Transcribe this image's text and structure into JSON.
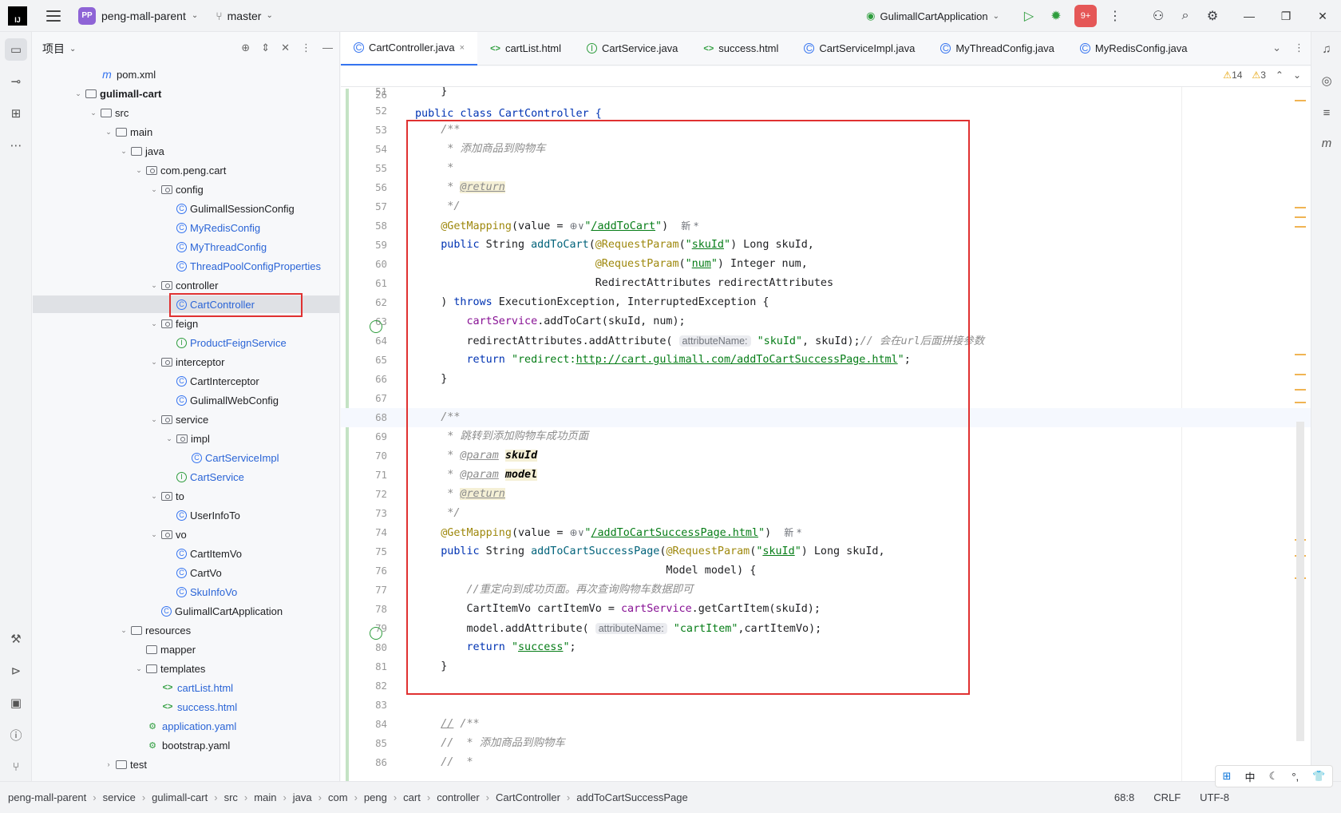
{
  "titlebar": {
    "project_badge": "PP",
    "project_name": "peng-mall-parent",
    "branch": "master",
    "run_config": "GulimallCartApplication",
    "notif_badge": "9+"
  },
  "project_panel": {
    "title": "项目",
    "tree": [
      {
        "label": "pom.xml",
        "icon": "maven-icon",
        "indent": 3,
        "arrow": "",
        "style": "normal"
      },
      {
        "label": "gulimall-cart",
        "icon": "module-folder-icon",
        "indent": 2,
        "arrow": "down",
        "style": "bold"
      },
      {
        "label": "src",
        "icon": "folder-icon",
        "indent": 3,
        "arrow": "down",
        "style": "normal"
      },
      {
        "label": "main",
        "icon": "folder-icon",
        "indent": 4,
        "arrow": "down",
        "style": "normal"
      },
      {
        "label": "java",
        "icon": "folder-icon",
        "indent": 5,
        "arrow": "down",
        "style": "normal"
      },
      {
        "label": "com.peng.cart",
        "icon": "package-icon",
        "indent": 6,
        "arrow": "down",
        "style": "normal"
      },
      {
        "label": "config",
        "icon": "package-icon",
        "indent": 7,
        "arrow": "down",
        "style": "normal"
      },
      {
        "label": "GulimallSessionConfig",
        "icon": "class-icon",
        "indent": 8,
        "arrow": "",
        "style": "normal"
      },
      {
        "label": "MyRedisConfig",
        "icon": "class-icon",
        "indent": 8,
        "arrow": "",
        "style": "blue"
      },
      {
        "label": "MyThreadConfig",
        "icon": "class-icon",
        "indent": 8,
        "arrow": "",
        "style": "blue"
      },
      {
        "label": "ThreadPoolConfigProperties",
        "icon": "class-icon",
        "indent": 8,
        "arrow": "",
        "style": "blue"
      },
      {
        "label": "controller",
        "icon": "package-icon",
        "indent": 7,
        "arrow": "down",
        "style": "normal"
      },
      {
        "label": "CartController",
        "icon": "class-icon",
        "indent": 8,
        "arrow": "",
        "style": "blue",
        "selected": true
      },
      {
        "label": "feign",
        "icon": "package-icon",
        "indent": 7,
        "arrow": "down",
        "style": "normal"
      },
      {
        "label": "ProductFeignService",
        "icon": "interface-icon",
        "indent": 8,
        "arrow": "",
        "style": "blue"
      },
      {
        "label": "interceptor",
        "icon": "package-icon",
        "indent": 7,
        "arrow": "down",
        "style": "normal"
      },
      {
        "label": "CartInterceptor",
        "icon": "class-icon",
        "indent": 8,
        "arrow": "",
        "style": "normal"
      },
      {
        "label": "GulimallWebConfig",
        "icon": "class-icon",
        "indent": 8,
        "arrow": "",
        "style": "normal"
      },
      {
        "label": "service",
        "icon": "package-icon",
        "indent": 7,
        "arrow": "down",
        "style": "normal"
      },
      {
        "label": "impl",
        "icon": "package-icon",
        "indent": 8,
        "arrow": "down",
        "style": "normal"
      },
      {
        "label": "CartServiceImpl",
        "icon": "class-icon",
        "indent": 9,
        "arrow": "",
        "style": "blue"
      },
      {
        "label": "CartService",
        "icon": "interface-icon",
        "indent": 8,
        "arrow": "",
        "style": "blue"
      },
      {
        "label": "to",
        "icon": "package-icon",
        "indent": 7,
        "arrow": "down",
        "style": "normal"
      },
      {
        "label": "UserInfoTo",
        "icon": "class-icon",
        "indent": 8,
        "arrow": "",
        "style": "normal"
      },
      {
        "label": "vo",
        "icon": "package-icon",
        "indent": 7,
        "arrow": "down",
        "style": "normal"
      },
      {
        "label": "CartItemVo",
        "icon": "class-icon",
        "indent": 8,
        "arrow": "",
        "style": "normal"
      },
      {
        "label": "CartVo",
        "icon": "class-icon",
        "indent": 8,
        "arrow": "",
        "style": "normal"
      },
      {
        "label": "SkuInfoVo",
        "icon": "class-icon",
        "indent": 8,
        "arrow": "",
        "style": "blue"
      },
      {
        "label": "GulimallCartApplication",
        "icon": "spring-class-icon",
        "indent": 7,
        "arrow": "",
        "style": "normal"
      },
      {
        "label": "resources",
        "icon": "folder-icon",
        "indent": 5,
        "arrow": "down",
        "style": "normal"
      },
      {
        "label": "mapper",
        "icon": "folder-icon",
        "indent": 6,
        "arrow": "",
        "style": "normal"
      },
      {
        "label": "templates",
        "icon": "folder-icon",
        "indent": 6,
        "arrow": "down",
        "style": "normal"
      },
      {
        "label": "cartList.html",
        "icon": "html-icon",
        "indent": 7,
        "arrow": "",
        "style": "blue"
      },
      {
        "label": "success.html",
        "icon": "html-icon",
        "indent": 7,
        "arrow": "",
        "style": "blue"
      },
      {
        "label": "application.yaml",
        "icon": "yaml-icon",
        "indent": 6,
        "arrow": "",
        "style": "blue"
      },
      {
        "label": "bootstrap.yaml",
        "icon": "yaml-icon",
        "indent": 6,
        "arrow": "",
        "style": "normal"
      },
      {
        "label": "test",
        "icon": "folder-icon",
        "indent": 4,
        "arrow": "right",
        "style": "normal"
      }
    ]
  },
  "tabs": [
    {
      "label": "CartController.java",
      "icon": "class",
      "active": true
    },
    {
      "label": "cartList.html",
      "icon": "html",
      "active": false
    },
    {
      "label": "CartService.java",
      "icon": "interface",
      "active": false
    },
    {
      "label": "success.html",
      "icon": "html",
      "active": false
    },
    {
      "label": "CartServiceImpl.java",
      "icon": "class",
      "active": false
    },
    {
      "label": "MyThreadConfig.java",
      "icon": "class",
      "active": false
    },
    {
      "label": "MyRedisConfig.java",
      "icon": "class",
      "active": false
    }
  ],
  "editor": {
    "warnings": "14",
    "weak_warnings": "3",
    "sticky_line_no": "26",
    "sticky_code": "public class CartController {",
    "lines": [
      {
        "n": "51",
        "html": "    }"
      },
      {
        "n": "52",
        "html": ""
      },
      {
        "n": "53",
        "html": "    <span class='c'>/**</span>"
      },
      {
        "n": "54",
        "html": "<span class='c'>     * 添加商品到购物车</span>"
      },
      {
        "n": "55",
        "html": "<span class='c'>     *</span>"
      },
      {
        "n": "56",
        "html": "<span class='c'>     * </span><span class='tag hl-tag'>@return</span>"
      },
      {
        "n": "57",
        "html": "<span class='c'>     */</span>"
      },
      {
        "n": "58",
        "html": "    <span class='a'>@GetMapping</span>(value = <span class='new'>⊕∨</span><span class='s'>\"<span class='u'>/addToCart</span>\"</span>)  <span class='new'>新 *</span>"
      },
      {
        "n": "59",
        "html": "    <span class='k'>public</span> String <span class='m'>addToCart</span>(<span class='a'>@RequestParam</span>(<span class='s'>\"<span class='u'>skuId</span>\"</span>) Long skuId,"
      },
      {
        "n": "60",
        "html": "                            <span class='a'>@RequestParam</span>(<span class='s'>\"<span class='u'>num</span>\"</span>) Integer num,"
      },
      {
        "n": "61",
        "html": "                            RedirectAttributes redirectAttributes"
      },
      {
        "n": "62",
        "html": "    ) <span class='k'>throws</span> ExecutionException, InterruptedException {"
      },
      {
        "n": "63",
        "html": "        <span class='f'>cartService</span>.addToCart(skuId, num);"
      },
      {
        "n": "64",
        "html": "        redirectAttributes.addAttribute( <span class='hint'>attributeName:</span> <span class='s'>\"skuId\"</span>, skuId);<span class='c'>// 会在url后面拼接参数</span>"
      },
      {
        "n": "65",
        "html": "        <span class='k'>return</span> <span class='s'>\"redirect:<span class='u'>http://cart.gulimall.com/addToCartSuccessPage.html</span>\"</span>;"
      },
      {
        "n": "66",
        "html": "    }"
      },
      {
        "n": "67",
        "html": ""
      },
      {
        "n": "68",
        "html": "    <span class='c'>/**</span>",
        "cur": true
      },
      {
        "n": "69",
        "html": "<span class='c'>     * 跳转到添加购物车成功页面</span>"
      },
      {
        "n": "70",
        "html": "<span class='c'>     * </span><span class='tag'>@param</span> <span class='param'>skuId</span>"
      },
      {
        "n": "71",
        "html": "<span class='c'>     * </span><span class='tag'>@param</span> <span class='param'>model</span>"
      },
      {
        "n": "72",
        "html": "<span class='c'>     * </span><span class='tag hl-tag'>@return</span>"
      },
      {
        "n": "73",
        "html": "<span class='c'>     */</span>"
      },
      {
        "n": "74",
        "html": "    <span class='a'>@GetMapping</span>(value = <span class='new'>⊕∨</span><span class='s'>\"<span class='u'>/addToCartSuccessPage.html</span>\"</span>)  <span class='new'>新 *</span>"
      },
      {
        "n": "75",
        "html": "    <span class='k'>public</span> String <span class='m'>addToCartSuccessPage</span>(<span class='a'>@RequestParam</span>(<span class='s'>\"<span class='u'>skuId</span>\"</span>) Long skuId,"
      },
      {
        "n": "76",
        "html": "                                       Model model) {"
      },
      {
        "n": "77",
        "html": "        <span class='c'>//重定向到成功页面。再次查询购物车数据即可</span>"
      },
      {
        "n": "78",
        "html": "        CartItemVo cartItemVo = <span class='f'>cartService</span>.getCartItem(skuId);"
      },
      {
        "n": "79",
        "html": "        model.addAttribute( <span class='hint'>attributeName:</span> <span class='s'>\"cartItem\"</span>,cartItemVo);"
      },
      {
        "n": "80",
        "html": "        <span class='k'>return</span> <span class='s'>\"<span class='u'>success</span>\"</span>;"
      },
      {
        "n": "81",
        "html": "    }"
      },
      {
        "n": "82",
        "html": ""
      },
      {
        "n": "83",
        "html": ""
      },
      {
        "n": "84",
        "html": "    <span class='c'><span class='u'>//</span> /**</span>"
      },
      {
        "n": "85",
        "html": "    <span class='c'>//  * 添加商品到购物车</span>"
      },
      {
        "n": "86",
        "html": "    <span class='c'>//  *</span>"
      }
    ]
  },
  "statusbar": {
    "crumbs": [
      "peng-mall-parent",
      "service",
      "gulimall-cart",
      "src",
      "main",
      "java",
      "com",
      "peng",
      "cart",
      "controller",
      "CartController",
      "addToCartSuccessPage"
    ],
    "position": "68:8",
    "line_sep": "CRLF",
    "encoding": "UTF-8"
  },
  "ime": {
    "lang": "中"
  }
}
